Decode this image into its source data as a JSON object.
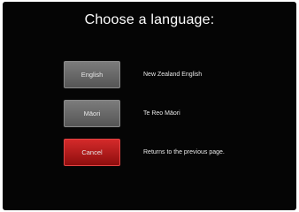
{
  "title": "Choose a language:",
  "options": [
    {
      "button_label": "English",
      "description": "New Zealand English"
    },
    {
      "button_label": "Māori",
      "description": "Te Reo Māori"
    }
  ],
  "cancel": {
    "button_label": "Cancel",
    "description": "Returns to the previous page."
  },
  "colors": {
    "background": "#050505",
    "button_gray": "#6a6a6a",
    "button_red": "#c21f1f",
    "text": "#ffffff"
  }
}
